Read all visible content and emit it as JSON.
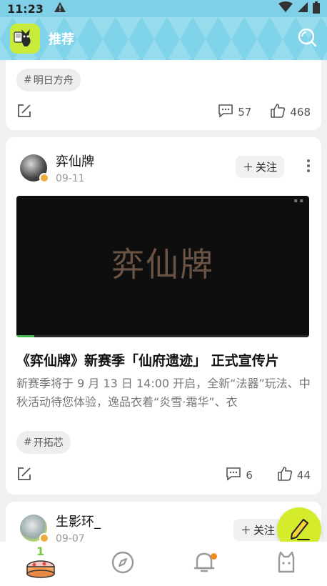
{
  "status_bar": {
    "time": "11:23"
  },
  "header": {
    "title": "推荐"
  },
  "posts": [
    {
      "tag": "明日方舟",
      "comments": "57",
      "likes": "468"
    },
    {
      "author": "弈仙牌",
      "date": "09-11",
      "follow_label": "关注",
      "video_logo": "弈仙牌",
      "title": "《弈仙牌》新赛季「仙府遗迹」 正式宣传片",
      "body": "新赛季将于 9 月 13 日 14:00 开启，全新“法器”玩法、中秋活动待您体验，逸品衣着“炎雪·霜华”、衣",
      "tag": "开拓芯",
      "comments": "6",
      "likes": "44"
    },
    {
      "author": "生影环_",
      "date": "09-07",
      "follow_label": "关注"
    }
  ],
  "colors": {
    "accent": "#7fd4ea",
    "fab": "#d4ec2c",
    "notify": "#f08a22"
  }
}
